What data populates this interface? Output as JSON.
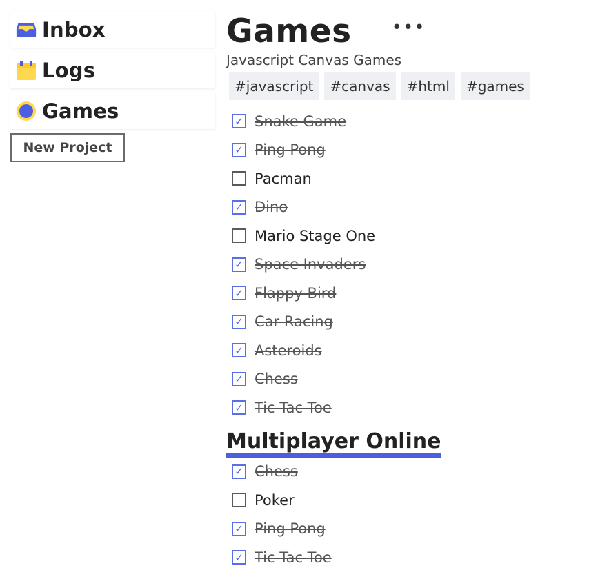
{
  "sidebar": {
    "items": [
      {
        "label": "Inbox",
        "icon": "inbox-tray-icon"
      },
      {
        "label": "Logs",
        "icon": "calendar-icon"
      },
      {
        "label": "Games",
        "icon": "circle-icon"
      }
    ],
    "new_project_label": "New Project"
  },
  "colors": {
    "accent": "#4b5fe0",
    "yellow": "#ffd84d",
    "tag_bg": "#eef0f3"
  },
  "project": {
    "title": "Games",
    "more_label": "•••",
    "subtitle": "Javascript Canvas Games",
    "tags": [
      "#javascript",
      "#canvas",
      "#html",
      "#games"
    ],
    "tasks": [
      {
        "text": "Snake Game",
        "done": true
      },
      {
        "text": "Ping Pong",
        "done": true
      },
      {
        "text": "Pacman",
        "done": false
      },
      {
        "text": "Dino",
        "done": true
      },
      {
        "text": "Mario Stage One",
        "done": false
      },
      {
        "text": "Space Invaders",
        "done": true
      },
      {
        "text": "Flappy Bird",
        "done": true
      },
      {
        "text": "Car Racing",
        "done": true
      },
      {
        "text": "Asteroids",
        "done": true
      },
      {
        "text": "Chess",
        "done": true
      },
      {
        "text": "Tic Tac Toe",
        "done": true
      }
    ],
    "sections": [
      {
        "title": "Multiplayer Online",
        "tasks": [
          {
            "text": "Chess",
            "done": true
          },
          {
            "text": "Poker",
            "done": false
          },
          {
            "text": "Ping Pong",
            "done": true
          },
          {
            "text": "Tic Tac Toe",
            "done": true
          }
        ]
      }
    ]
  }
}
